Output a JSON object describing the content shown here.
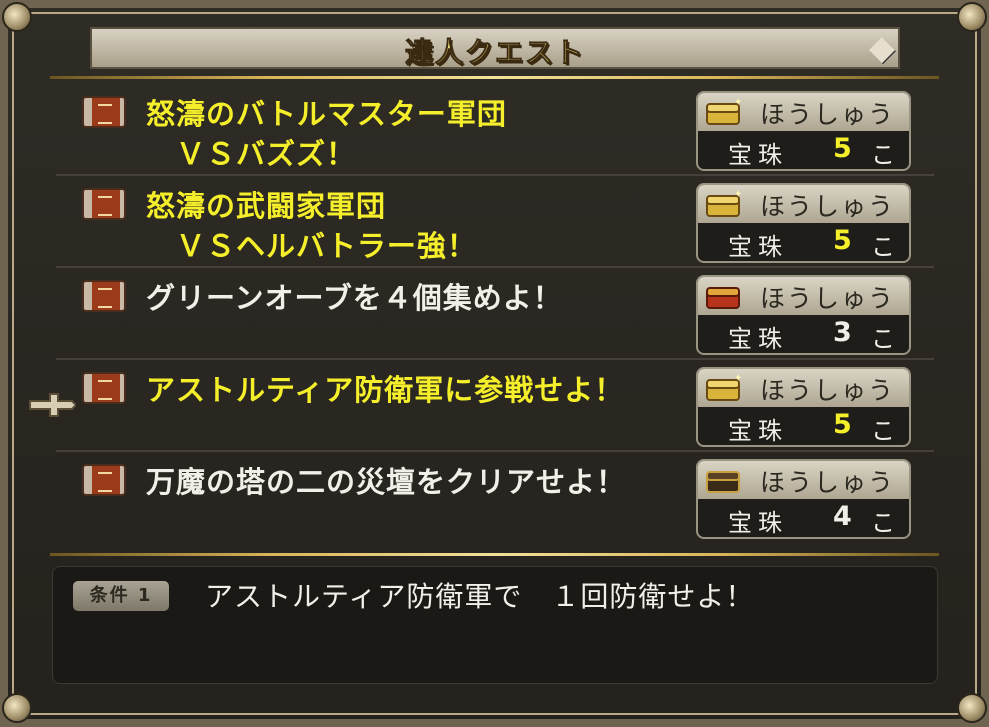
{
  "window": {
    "title": "達人クエスト"
  },
  "quests": [
    {
      "title_line1": "怒濤のバトルマスター軍団",
      "title_line2": "ＶＳバズズ！",
      "color": "#f5ee2a",
      "reward_label": "ほうしゅう",
      "reward_item": "宝珠",
      "reward_count": "5",
      "reward_unit": "こ",
      "count_color": "#f5ee2a",
      "chest": "sparkle-gold-chest-icon"
    },
    {
      "title_line1": "怒濤の武闘家軍団",
      "title_line2": "ＶＳヘルバトラー強！",
      "color": "#f5ee2a",
      "reward_label": "ほうしゅう",
      "reward_item": "宝珠",
      "reward_count": "5",
      "reward_unit": "こ",
      "count_color": "#f5ee2a",
      "chest": "sparkle-gold-chest-icon"
    },
    {
      "title_line1": "グリーンオーブを４個集めよ！",
      "title_line2": "",
      "color": "#f2efe8",
      "reward_label": "ほうしゅう",
      "reward_item": "宝珠",
      "reward_count": "3",
      "reward_unit": "こ",
      "count_color": "#f2efe8",
      "chest": "red-chest-icon"
    },
    {
      "title_line1": "アストルティア防衛軍に参戦せよ！",
      "title_line2": "",
      "color": "#f5ee2a",
      "reward_label": "ほうしゅう",
      "reward_item": "宝珠",
      "reward_count": "5",
      "reward_unit": "こ",
      "count_color": "#f5ee2a",
      "chest": "sparkle-gold-chest-icon"
    },
    {
      "title_line1": "万魔の塔の二の災壇をクリアせよ！",
      "title_line2": "",
      "color": "#f2efe8",
      "reward_label": "ほうしゅう",
      "reward_item": "宝珠",
      "reward_count": "4",
      "reward_unit": "こ",
      "count_color": "#f2efe8",
      "chest": "dark-chest-icon"
    }
  ],
  "selected_index": 3,
  "condition": {
    "badge": "条件 1",
    "text": "アストルティア防衛軍で　１回防衛せよ！"
  }
}
